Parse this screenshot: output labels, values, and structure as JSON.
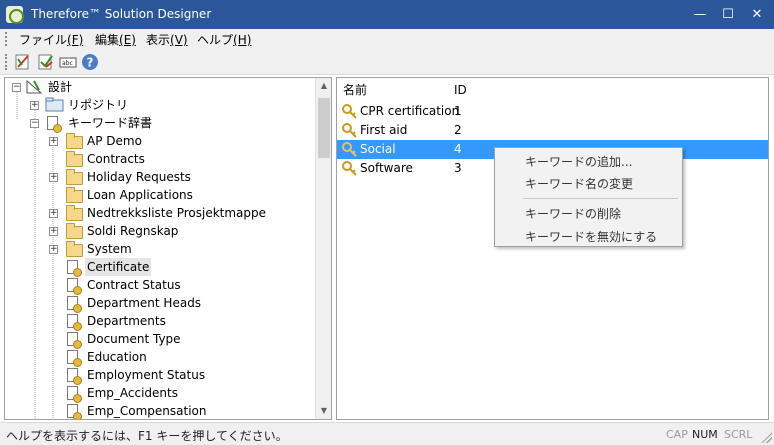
{
  "window": {
    "title": "Therefore™ Solution Designer",
    "minimize": "—",
    "maximize": "☐",
    "close": "✕"
  },
  "menu": [
    {
      "label": "ファイル",
      "key": "(F)"
    },
    {
      "label": "編集",
      "key": "(E)"
    },
    {
      "label": "表示",
      "key": "(V)"
    },
    {
      "label": "ヘルプ",
      "key": "(H)"
    }
  ],
  "toolbar": [
    "edit-icon",
    "checkmark-icon",
    "text-format-icon",
    "help-icon"
  ],
  "tree": {
    "root": "設計",
    "repository": "リポジトリ",
    "keyword_dict": "キーワード辞書",
    "folders": [
      "AP Demo",
      "Contracts",
      "Holiday Requests",
      "Loan Applications",
      "Nedtrekksliste Prosjektmappe",
      "Soldi Regnskap",
      "System"
    ],
    "items": [
      "Certificate",
      "Contract Status",
      "Department Heads",
      "Departments",
      "Document Type",
      "Education",
      "Employment Status",
      "Emp_Accidents",
      "Emp_Compensation"
    ]
  },
  "list": {
    "headers": {
      "name": "名前",
      "id": "ID"
    },
    "rows": [
      {
        "name": "CPR certification",
        "id": "1"
      },
      {
        "name": "First aid",
        "id": "2"
      },
      {
        "name": "Social",
        "id": "4"
      },
      {
        "name": "Software",
        "id": "3"
      }
    ]
  },
  "context_menu": {
    "add": "キーワードの追加...",
    "rename": "キーワード名の変更",
    "delete": "キーワードの削除",
    "disable": "キーワードを無効にする"
  },
  "status": {
    "text": "ヘルプを表示するには、F1 キーを押してください。",
    "cap": "CAP",
    "num": "NUM",
    "scrl": "SCRL"
  }
}
